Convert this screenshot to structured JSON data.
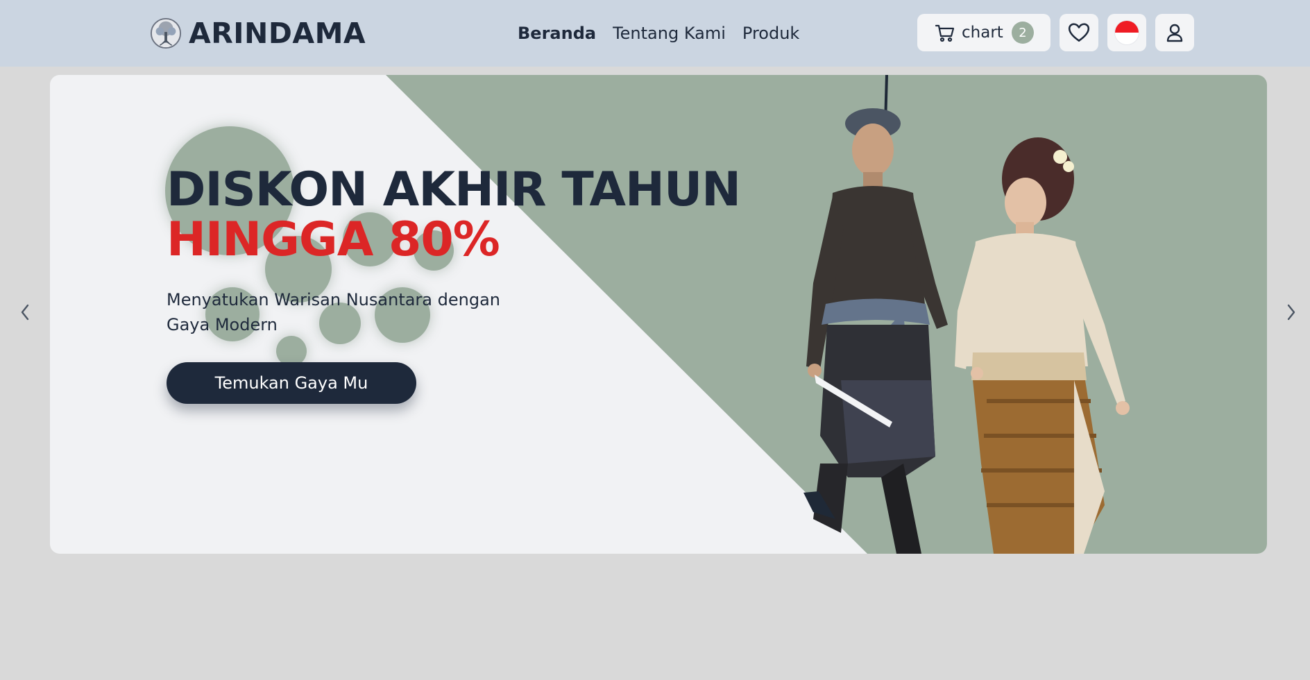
{
  "header": {
    "brand": "ARINDAMA",
    "nav": [
      {
        "label": "Beranda",
        "active": true
      },
      {
        "label": "Tentang Kami",
        "active": false
      },
      {
        "label": "Produk",
        "active": false
      }
    ],
    "cart": {
      "label": "chart",
      "count": "2",
      "icon": "cart-icon"
    },
    "wishlist": {
      "icon": "heart-icon"
    },
    "language": {
      "icon": "indonesia-flag-icon"
    },
    "account": {
      "icon": "user-icon"
    }
  },
  "banner": {
    "headline_line1": "DISKON AKHIR TAHUN",
    "headline_line2": "HINGGA 80%",
    "subtitle": "Menyatukan Warisan Nusantara dengan Gaya Modern",
    "cta_label": "Temukan Gaya Mu",
    "prev_icon": "chevron-left-icon",
    "next_icon": "chevron-right-icon"
  },
  "colors": {
    "header_bg": "#cbd5e1",
    "page_bg": "#d9d9d9",
    "banner_bg": "#f1f2f4",
    "sage": "#9cae9f",
    "navy": "#1e293b",
    "red": "#dc2626",
    "badge": "#9cae9f"
  }
}
